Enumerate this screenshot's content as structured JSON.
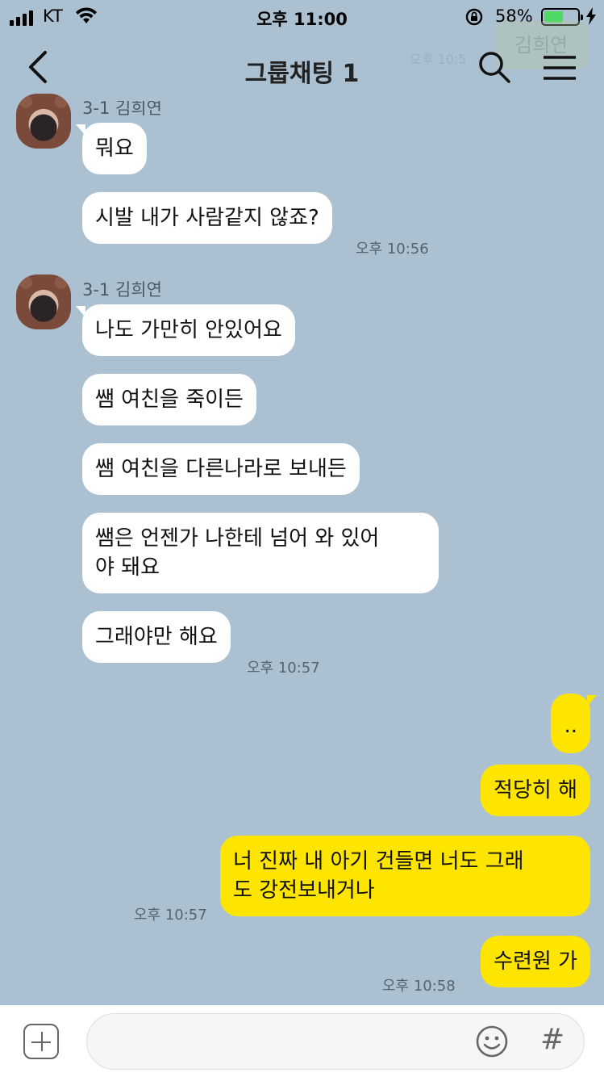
{
  "status_bar": {
    "carrier": "KT",
    "time": "오후 11:00",
    "battery_percent": "58%",
    "battery_level": 0.58,
    "icons": [
      "signal-icon",
      "wifi-icon",
      "rotation-lock-icon",
      "battery-icon",
      "charging-icon"
    ]
  },
  "header": {
    "title": "그룹채팅 1",
    "icons": [
      "back-arrow-icon",
      "search-icon",
      "menu-icon"
    ]
  },
  "ghost": {
    "time": "오후 10:5",
    "name": "김희연"
  },
  "chat": {
    "groups": [
      {
        "sender": "3-1 김희연",
        "messages": [
          "뭐요",
          "시발 내가 사람같지 않죠?"
        ],
        "time": "오후 10:56"
      },
      {
        "sender": "3-1 김희연",
        "messages": [
          "나도 가만히 안있어요",
          "쌤 여친을 죽이든",
          "쌤 여친을 다른나라로 보내든",
          "쌤은 언젠가 나한테 넘어 와 있어\n야 돼요",
          "그래야만 해요"
        ],
        "time": "오후 10:57"
      }
    ],
    "mine": [
      {
        "text": "..",
        "time": ""
      },
      {
        "text": "적당히 해",
        "time": ""
      },
      {
        "text": "너 진짜 내 아기 건들면 너도 그래\n도 강전보내거나",
        "time": "오후 10:57"
      },
      {
        "text": "수련원 가",
        "time": "오후 10:58"
      }
    ]
  },
  "input_bar": {
    "placeholder": "",
    "hash_label": "#",
    "icons": [
      "add-icon",
      "emoji-icon",
      "hashtag-icon"
    ]
  },
  "colors": {
    "background": "#abc1d1",
    "my_bubble": "#fee500",
    "their_bubble": "#ffffff"
  }
}
